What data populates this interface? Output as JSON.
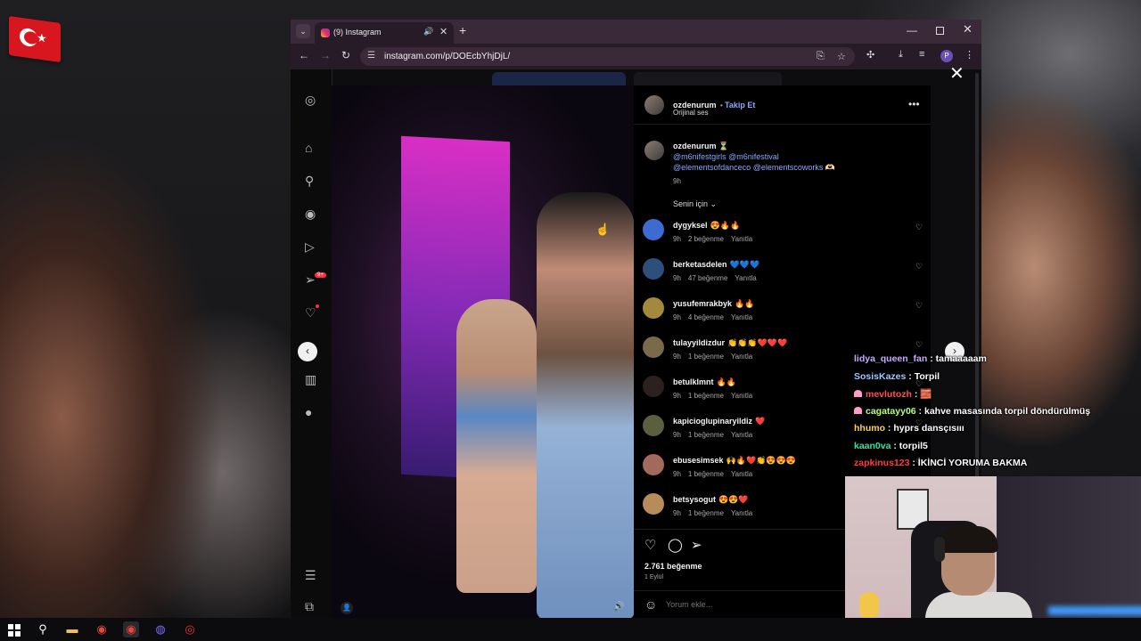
{
  "browser": {
    "tab_title": "(9) Instagram",
    "url": "instagram.com/p/DOEcbYhjDjL/",
    "profile_initial": "P"
  },
  "post": {
    "author": "ozdenurum",
    "follow_label": "Takip Et",
    "audio": "Orijinal ses",
    "caption_author": "ozdenurum",
    "caption_emoji": "⏳",
    "caption_mentions_1": "@m6nifestgirls @m6nifestival",
    "caption_mentions_2": "@elementsofdanceco @elementscoworks",
    "caption_tail": "🫶🏻",
    "caption_time": "9h",
    "sort_label": "Senin için",
    "likes": "2.761 beğenme",
    "date": "1 Eylül",
    "add_comment_placeholder": "Yorum ekle..."
  },
  "comments": [
    {
      "user": "dygyksel",
      "text": "😍🔥🔥",
      "time": "9h",
      "likes": "2 beğenme",
      "reply": "Yanıtla",
      "avatar_color": "#3e6bd1"
    },
    {
      "user": "berketasdelen",
      "text": "💙💙💙",
      "time": "9h",
      "likes": "47 beğenme",
      "reply": "Yanıtla",
      "avatar_color": "#2c4f7c"
    },
    {
      "user": "yusufemrakbyk",
      "text": "🔥🔥",
      "time": "9h",
      "likes": "4 beğenme",
      "reply": "Yanıtla",
      "avatar_color": "#a4893c"
    },
    {
      "user": "tulayyildizdur",
      "text": "👏👏👏❤️❤️❤️",
      "time": "9h",
      "likes": "1 beğenme",
      "reply": "Yanıtla",
      "avatar_color": "#7a6a4c"
    },
    {
      "user": "betulklmnt",
      "text": "🔥🔥",
      "time": "9h",
      "likes": "1 beğenme",
      "reply": "Yanıtla",
      "avatar_color": "#2d2020"
    },
    {
      "user": "kapicioglupinaryildiz",
      "text": "❤️",
      "time": "9h",
      "likes": "1 beğenme",
      "reply": "Yanıtla",
      "avatar_color": "#5c5f3d"
    },
    {
      "user": "ebusesimsek",
      "text": "🙌🔥❤️👏😍😍😍",
      "time": "9h",
      "likes": "1 beğenme",
      "reply": "Yanıtla",
      "avatar_color": "#a26a5c"
    },
    {
      "user": "betsysogut",
      "text": "😍😍❤️",
      "time": "9h",
      "likes": "1 beğenme",
      "reply": "Yanıtla",
      "avatar_color": "#b58c5a"
    }
  ],
  "chat": [
    {
      "user": "lidya_queen_fan",
      "msg": "tamaaaaam",
      "color": "#c9a8ff",
      "badge": false
    },
    {
      "user": "SosisKazes",
      "msg": "Torpil",
      "color": "#9ec7ff",
      "badge": false
    },
    {
      "user": "mevlutozh",
      "msg": "🧱",
      "color": "#ff4f4f",
      "badge": true
    },
    {
      "user": "cagatayy06",
      "msg": "kahve masasında torpil döndürülmüş",
      "color": "#b6ff7a",
      "badge": true
    },
    {
      "user": "hhumo",
      "msg": "hyprs dansçısııı",
      "color": "#ffd34a",
      "badge": false
    },
    {
      "user": "kaan0va",
      "msg": "torpil5",
      "color": "#35e0a8",
      "badge": false
    },
    {
      "user": "zapkinus123",
      "msg": "İKİNCİ YORUMA BAKMA",
      "color": "#ff3b3b",
      "badge": false
    }
  ],
  "colors": {
    "accent_link": "#8ca8ff",
    "like_red": "#ff3040",
    "tab_bar": "#3a2a39"
  }
}
